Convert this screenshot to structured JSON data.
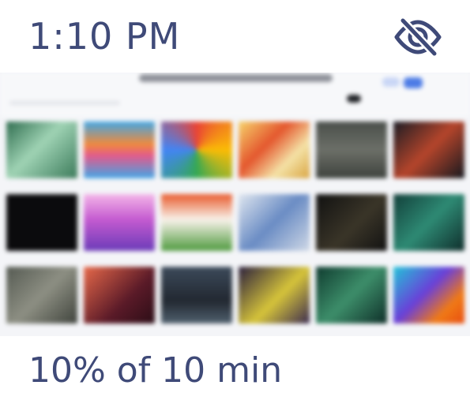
{
  "status": {
    "time": "1:10 PM",
    "hide_icon": "eye-slash-icon"
  },
  "preview": {
    "description_icon": "blurred-photo-gallery",
    "thumbnail_count": 18
  },
  "progress": {
    "label": "10% of 10 min",
    "fraction": 0.1
  },
  "colors": {
    "text": "#3f4a78",
    "background": "#ffffff"
  }
}
